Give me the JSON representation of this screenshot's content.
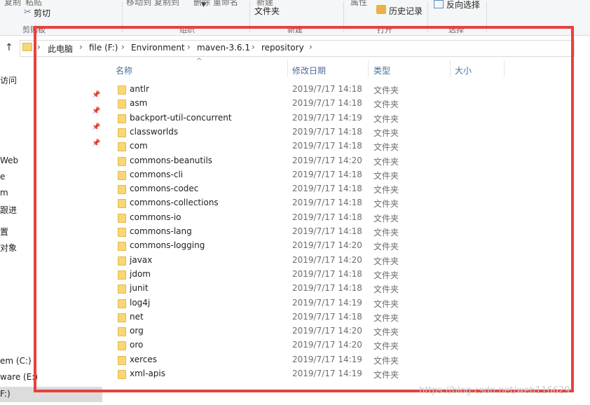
{
  "ribbon": {
    "cut_top_1": "复制",
    "cut_top_2": "粘贴",
    "cut_label": "剪切",
    "move_copy": "移动到 复制到",
    "delete_rename": "删除 重命名",
    "new_folder": "文件夹",
    "new_top": "新建",
    "properties": "属性",
    "history": "历史记录",
    "invert": "反向选择",
    "groups": [
      "剪贴板",
      "组织",
      "新建",
      "打开",
      "选择"
    ]
  },
  "address": {
    "crumbs": [
      "此电脑",
      "file (F:)",
      "Environment",
      "maven-3.6.1",
      "repository"
    ]
  },
  "nav": {
    "items": [
      "访问",
      "Web",
      "e",
      "m",
      "跟进",
      "置",
      "对象",
      "em (C:)",
      "ware (E:)",
      "F:)"
    ]
  },
  "columns": {
    "name": "名称",
    "date": "修改日期",
    "type": "类型",
    "size": "大小"
  },
  "files": [
    {
      "name": "antlr",
      "date": "2019/7/17 14:18",
      "type": "文件夹"
    },
    {
      "name": "asm",
      "date": "2019/7/17 14:18",
      "type": "文件夹"
    },
    {
      "name": "backport-util-concurrent",
      "date": "2019/7/17 14:19",
      "type": "文件夹"
    },
    {
      "name": "classworlds",
      "date": "2019/7/17 14:18",
      "type": "文件夹"
    },
    {
      "name": "com",
      "date": "2019/7/17 14:18",
      "type": "文件夹"
    },
    {
      "name": "commons-beanutils",
      "date": "2019/7/17 14:20",
      "type": "文件夹"
    },
    {
      "name": "commons-cli",
      "date": "2019/7/17 14:18",
      "type": "文件夹"
    },
    {
      "name": "commons-codec",
      "date": "2019/7/17 14:18",
      "type": "文件夹"
    },
    {
      "name": "commons-collections",
      "date": "2019/7/17 14:18",
      "type": "文件夹"
    },
    {
      "name": "commons-io",
      "date": "2019/7/17 14:18",
      "type": "文件夹"
    },
    {
      "name": "commons-lang",
      "date": "2019/7/17 14:18",
      "type": "文件夹"
    },
    {
      "name": "commons-logging",
      "date": "2019/7/17 14:20",
      "type": "文件夹"
    },
    {
      "name": "javax",
      "date": "2019/7/17 14:20",
      "type": "文件夹"
    },
    {
      "name": "jdom",
      "date": "2019/7/17 14:18",
      "type": "文件夹"
    },
    {
      "name": "junit",
      "date": "2019/7/17 14:18",
      "type": "文件夹"
    },
    {
      "name": "log4j",
      "date": "2019/7/17 14:19",
      "type": "文件夹"
    },
    {
      "name": "net",
      "date": "2019/7/17 14:18",
      "type": "文件夹"
    },
    {
      "name": "org",
      "date": "2019/7/17 14:20",
      "type": "文件夹"
    },
    {
      "name": "oro",
      "date": "2019/7/17 14:20",
      "type": "文件夹"
    },
    {
      "name": "xerces",
      "date": "2019/7/17 14:19",
      "type": "文件夹"
    },
    {
      "name": "xml-apis",
      "date": "2019/7/17 14:19",
      "type": "文件夹"
    }
  ],
  "watermark": "https://blog.csdn.net/web116629",
  "colors": {
    "highlight_box": "#e8413d",
    "folder": "#f8d775",
    "header_text": "#4a6e96"
  }
}
